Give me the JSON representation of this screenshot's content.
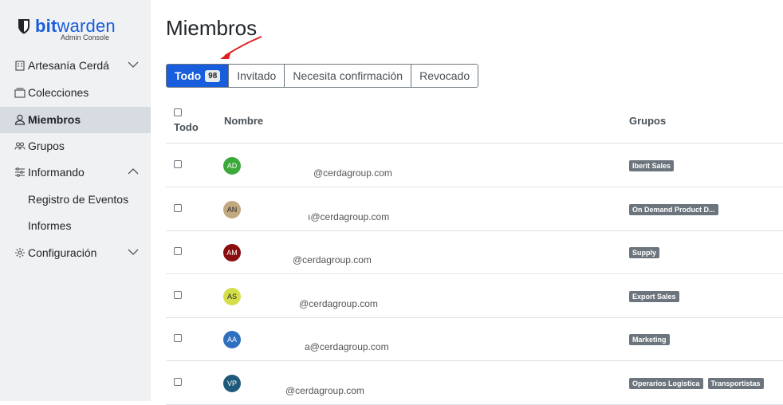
{
  "brand": {
    "name_bold": "bit",
    "name_rest": "warden",
    "subtitle": "Admin Console"
  },
  "sidebar": {
    "items": [
      {
        "label": "Artesanía Cerdá",
        "icon": "building-icon",
        "chevron": "down"
      },
      {
        "label": "Colecciones",
        "icon": "collections-icon"
      },
      {
        "label": "Miembros",
        "icon": "user-icon",
        "active": true
      },
      {
        "label": "Grupos",
        "icon": "users-icon"
      },
      {
        "label": "Informando",
        "icon": "sliders-icon",
        "chevron": "up"
      },
      {
        "label": "Registro de Eventos",
        "sub": true
      },
      {
        "label": "Informes",
        "sub": true
      },
      {
        "label": "Configuración",
        "icon": "gear-icon",
        "chevron": "down"
      }
    ]
  },
  "main": {
    "title": "Miembros",
    "tabs": [
      {
        "label": "Todo",
        "count": "98",
        "active": true
      },
      {
        "label": "Invitado"
      },
      {
        "label": "Necesita confirmación"
      },
      {
        "label": "Revocado"
      }
    ],
    "table": {
      "headers": {
        "all": "Todo",
        "name": "Nombre",
        "groups": "Grupos"
      },
      "rows": [
        {
          "initials": "AD",
          "avatar_bg": "#3aa93a",
          "avatar_fg": "#ffffff",
          "email": "@cerdagroup.com",
          "groups": [
            "Iberit Sales"
          ]
        },
        {
          "initials": "AN",
          "avatar_bg": "#c2a880",
          "avatar_fg": "#212529",
          "email": "ı@cerdagroup.com",
          "groups": [
            "On Demand Product D..."
          ]
        },
        {
          "initials": "AM",
          "avatar_bg": "#8b0d0d",
          "avatar_fg": "#ffffff",
          "email": "@cerdagroup.com",
          "groups": [
            "Supply"
          ]
        },
        {
          "initials": "AS",
          "avatar_bg": "#d4dd4a",
          "avatar_fg": "#212529",
          "email": "@cerdagroup.com",
          "groups": [
            "Export Sales"
          ]
        },
        {
          "initials": "AA",
          "avatar_bg": "#2f6fbf",
          "avatar_fg": "#ffffff",
          "email": "a@cerdagroup.com",
          "groups": [
            "Marketing"
          ]
        },
        {
          "initials": "VP",
          "avatar_bg": "#1f5a7a",
          "avatar_fg": "#ffffff",
          "email": "@cerdagroup.com",
          "groups": [
            "Operarios Logistica",
            "Transportistas"
          ]
        }
      ]
    }
  },
  "colors": {
    "accent": "#175ddc",
    "sidebar_bg": "#f0f1f3",
    "active_nav_bg": "#d7dce3",
    "badge_bg": "#6c757d",
    "annotation_arrow": "#e02020"
  }
}
